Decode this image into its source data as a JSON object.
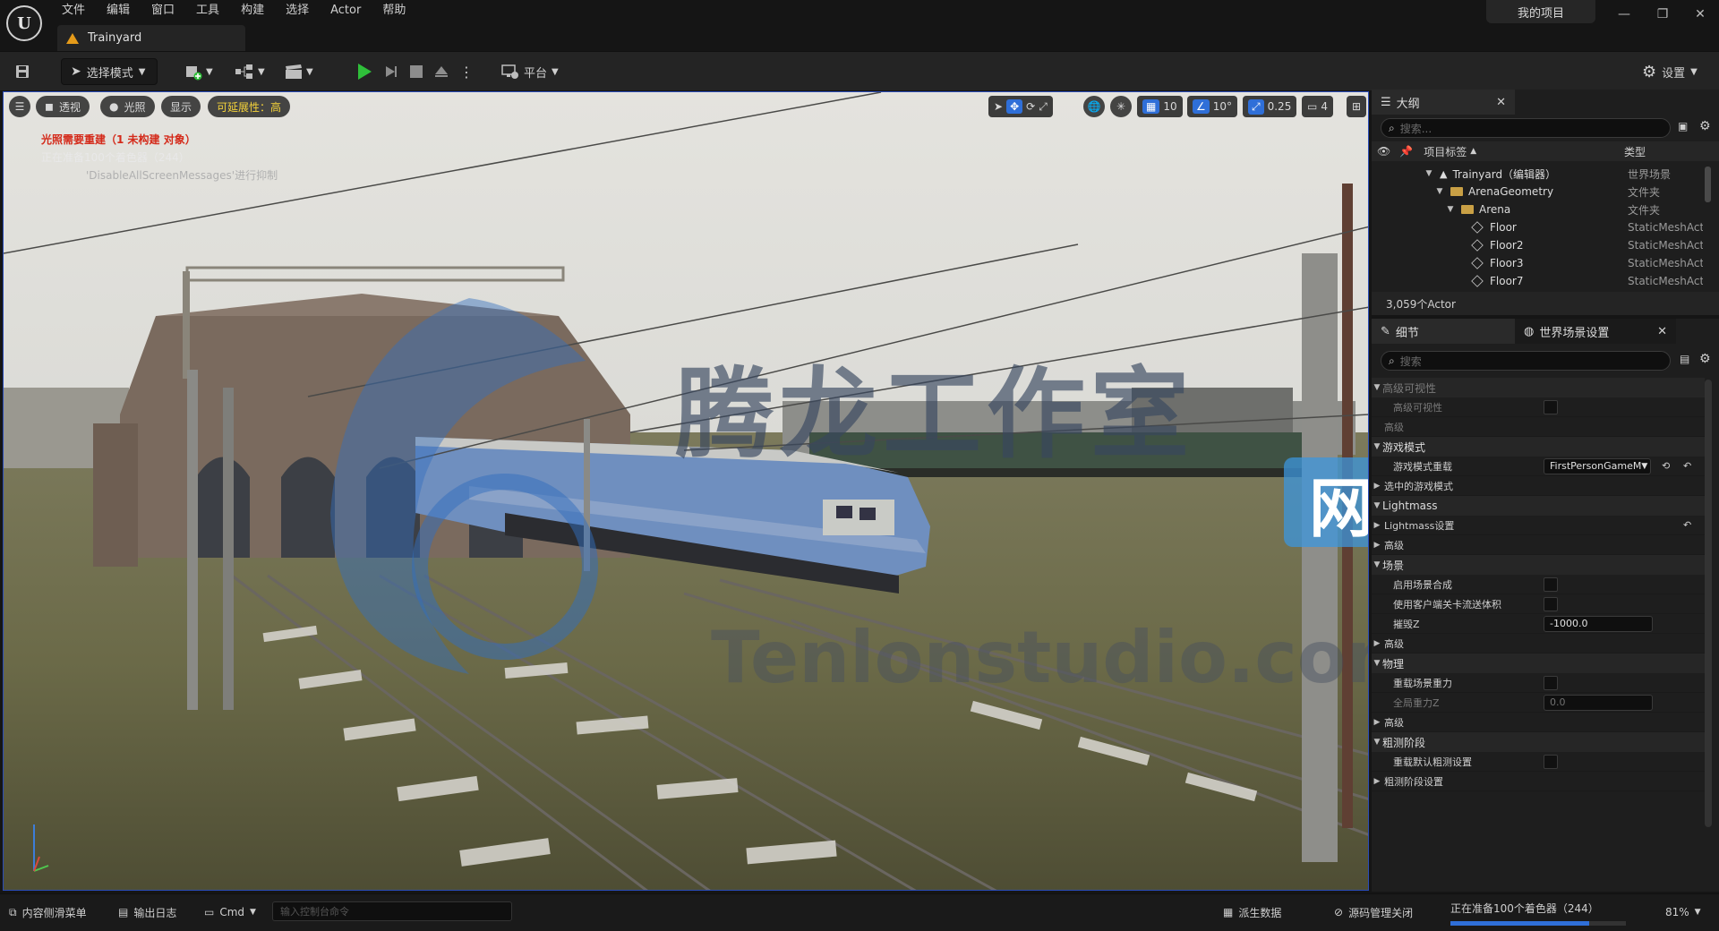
{
  "menu": {
    "items": [
      "文件",
      "编辑",
      "窗口",
      "工具",
      "构建",
      "选择",
      "Actor",
      "帮助"
    ],
    "level_tab": "Trainyard",
    "project": "我的项目"
  },
  "toolbar": {
    "mode": "选择模式",
    "platform": "平台",
    "settings": "设置"
  },
  "viewport": {
    "pills": [
      "透视",
      "光照",
      "显示"
    ],
    "scalability": "可延展性：高",
    "grid_value": "10",
    "rotation_value": "10°",
    "scale_value": "0.25",
    "camera_speed": "4",
    "messages": {
      "line1": "光照需要重建（1 未构建 对象）",
      "line2": "正在准备100个着色器（244）",
      "line3": "'DisableAllScreenMessages'进行抑制"
    },
    "watermark": {
      "text": "腾龙工作室",
      "site": "网站",
      "url": "Tenlonstudio.com"
    }
  },
  "outliner": {
    "tab": "大纲",
    "search_placeholder": "搜索...",
    "col_label": "项目标签",
    "col_type": "类型",
    "rows": [
      {
        "label": "Trainyard（编辑器）",
        "type": "世界场景",
        "icon": "level-icon"
      },
      {
        "label": "ArenaGeometry",
        "type": "文件夹",
        "icon": "folder-icon"
      },
      {
        "label": "Arena",
        "type": "文件夹",
        "icon": "folder-icon"
      },
      {
        "label": "Floor",
        "type": "StaticMeshActor",
        "icon": "static-mesh-icon"
      },
      {
        "label": "Floor2",
        "type": "StaticMeshActor",
        "icon": "static-mesh-icon"
      },
      {
        "label": "Floor3",
        "type": "StaticMeshActor",
        "icon": "static-mesh-icon"
      },
      {
        "label": "Floor7",
        "type": "StaticMeshActor",
        "icon": "static-mesh-icon"
      }
    ],
    "count": "3,059个Actor"
  },
  "details": {
    "tab1": "细节",
    "tab2": "世界场景设置",
    "search_placeholder": "搜索",
    "rows": {
      "r0": "高级可视性",
      "r1": "高级可视性",
      "r2": "高级",
      "c_gamemode": "游戏模式",
      "gamemode_override": "游戏模式重载",
      "gamemode_value": "FirstPersonGameM",
      "selected_gamemode": "选中的游戏模式",
      "c_lightmass": "Lightmass",
      "lightmass_settings": "Lightmass设置",
      "advanced1": "高级",
      "c_world": "场景",
      "enable_composition": "启用场景合成",
      "client_streaming": "使用客户端关卡流送体积",
      "kill_z": "摧毁Z",
      "kill_z_value": "-1000.0",
      "advanced2": "高级",
      "c_physics": "物理",
      "override_gravity": "重载场景重力",
      "global_gravity": "全局重力Z",
      "gravity_value": "0.0",
      "advanced3": "高级",
      "c_precomputed": "粗测阶段",
      "override_precomputed": "重载默认粗测设置",
      "precomputed_settings": "粗测阶段设置"
    }
  },
  "statusbar": {
    "content_drawer": "内容侧滑菜单",
    "output_log": "输出日志",
    "cmd": "Cmd",
    "console_placeholder": "输入控制台命令",
    "derived_data": "派生数据",
    "source_control": "源码管理关闭",
    "shader_status": "正在准备100个着色器（244）",
    "percent": "81%",
    "progress_fraction": 0.79
  },
  "colors": {
    "accent_blue": "#2f6fd8",
    "play_green": "#2fbf3a",
    "warning_red": "#d42a1a",
    "scalability_yellow": "#f4d23a"
  }
}
